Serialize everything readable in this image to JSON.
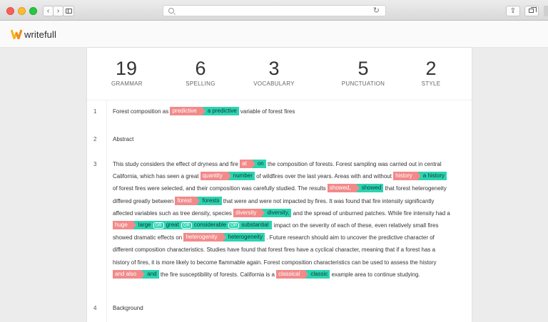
{
  "browser": {
    "back_label": "‹",
    "forward_label": "›",
    "reload_label": "↻",
    "share_label": "⇪"
  },
  "app": {
    "name": "writefull",
    "logo_colors": [
      "#f6b21d",
      "#f48a1a"
    ]
  },
  "stats": [
    {
      "value": "19",
      "label": "GRAMMAR"
    },
    {
      "value": "6",
      "label": "SPELLING"
    },
    {
      "value": "3",
      "label": "VOCABULARY"
    },
    {
      "value": "5",
      "label": "PUNCTUATION"
    },
    {
      "value": "2",
      "label": "STYLE"
    }
  ],
  "colors": {
    "deletion": "#f28a8a",
    "insertion": "#2dd3b0"
  },
  "paragraphs": {
    "p1": {
      "num": "1",
      "t1": "Forest composition as ",
      "d1": "predictive",
      "i1": "a predictive",
      "t2": " variable of forest fires"
    },
    "p2": {
      "num": "2",
      "text": "Abstract"
    },
    "p3": {
      "num": "3",
      "t1": "This study considers the effect of dryness and fire ",
      "d1": "at",
      "i1": "on",
      "t2": " the composition of forests. Forest sampling was carried out in central California, which has seen a great ",
      "d2": "quantity",
      "i2": "number",
      "t3": " of wildfires over the last years. Areas with and without ",
      "d3": "history",
      "i3": "a history",
      "t4": " of forest fires were selected, and their composition was carefully studied. The results ",
      "d4": "showed,",
      "i4": "showed",
      "t5": " that forest heterogeneity differed greatly between ",
      "d5": "forest",
      "i5": "forests",
      "t6": " that were and were not impacted by fires. It was found that fire intensity significantly affected variables such as tree density, species ",
      "d6": "diversity",
      "i6": "diversity,",
      "t7": " and the spread of unburned patches. While fire intensity had a ",
      "d7": "huge",
      "i7a": "large",
      "or": "OR",
      "i7b": "great",
      "i7c": "considerable",
      "i7d": "substantial",
      "t8": " impact on the severity of each of these, even relatively small fires showed dramatic effects on ",
      "d8": "heterogenity",
      "i8": "heterogeneity",
      "t9": " . Future research should aim to uncover the predictive character of different composition characteristics. Studies have found that forest fires have a cyclical character, meaning that if a forest has a history of fires, it is more likely to become flammable again. Forest composition characteristics can be used to assess the history ",
      "d9": "and also",
      "i9": "and",
      "t10": " the fire susceptibility of forests. California is a ",
      "d10": "classical",
      "i10": "classic",
      "t11": " example area to continue studying."
    },
    "p4": {
      "num": "4",
      "text": "Background"
    }
  }
}
